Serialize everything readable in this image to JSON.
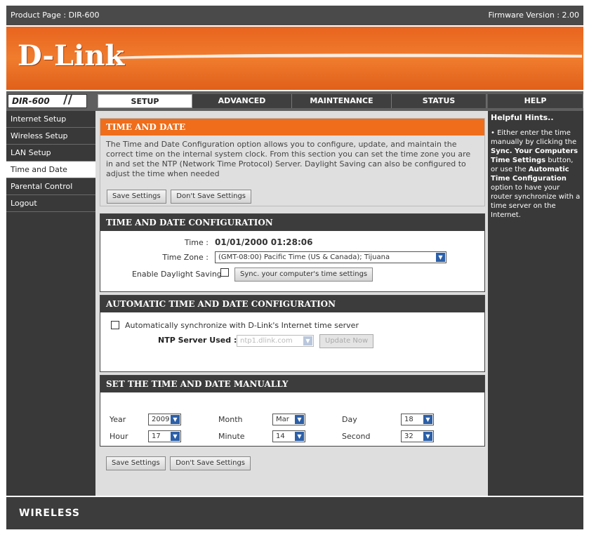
{
  "topbar": {
    "product": "Product Page : DIR-600",
    "firmware": "Firmware Version : 2.00"
  },
  "brand": {
    "logo": "D-Link"
  },
  "model": {
    "name": "DIR-600",
    "slashes": "//"
  },
  "tabs": [
    "SETUP",
    "ADVANCED",
    "MAINTENANCE",
    "STATUS",
    "HELP"
  ],
  "sidebar": {
    "items": [
      "Internet Setup",
      "Wireless Setup",
      "LAN Setup",
      "Time and Date",
      "Parental Control",
      "Logout"
    ]
  },
  "intro": {
    "title": "TIME AND DATE",
    "text": "The Time and Date Configuration option allows you to configure, update, and maintain the correct time on the internal system clock. From this section you can set the time zone you are in and set the NTP (Network Time Protocol) Server. Daylight Saving can also be configured to adjust the time when needed",
    "save": "Save Settings",
    "dont_save": "Don't Save Settings"
  },
  "config": {
    "title": "TIME AND DATE CONFIGURATION",
    "time_label": "Time :",
    "time_value": "01/01/2000 01:28:06",
    "tz_label": "Time Zone :",
    "tz_value": "(GMT-08:00) Pacific Time (US & Canada); Tijuana",
    "dst_label": "Enable Daylight Saving :",
    "sync_btn": "Sync. your computer's time settings"
  },
  "auto": {
    "title": "AUTOMATIC TIME AND DATE CONFIGURATION",
    "check_label": "Automatically synchronize with D-Link's Internet time server",
    "ntp_label": "NTP Server Used :",
    "ntp_value": "ntp1.dlink.com",
    "update_btn": "Update Now"
  },
  "manual": {
    "title": "SET THE TIME AND DATE MANUALLY",
    "year_label": "Year",
    "year": "2009",
    "month_label": "Month",
    "month": "Mar",
    "day_label": "Day",
    "day": "18",
    "hour_label": "Hour",
    "hour": "17",
    "minute_label": "Minute",
    "minute": "14",
    "second_label": "Second",
    "second": "32"
  },
  "bottom": {
    "save": "Save Settings",
    "dont_save": "Don't Save Settings"
  },
  "help": {
    "title": "Helpful Hints..",
    "bullet": "•",
    "t1": " Either enter the time manually by clicking the ",
    "b1": "Sync. Your Computers Time Settings",
    "t2": " button, or use the ",
    "b2": "Automatic Time Configuration",
    "t3": " option to have your router synchronize with a time server on the Internet."
  },
  "footer": {
    "label": "WIRELESS"
  },
  "colors": {
    "orange": "#ef6d1b",
    "dark": "#393939",
    "select_arrow": "#2b5fa8"
  }
}
